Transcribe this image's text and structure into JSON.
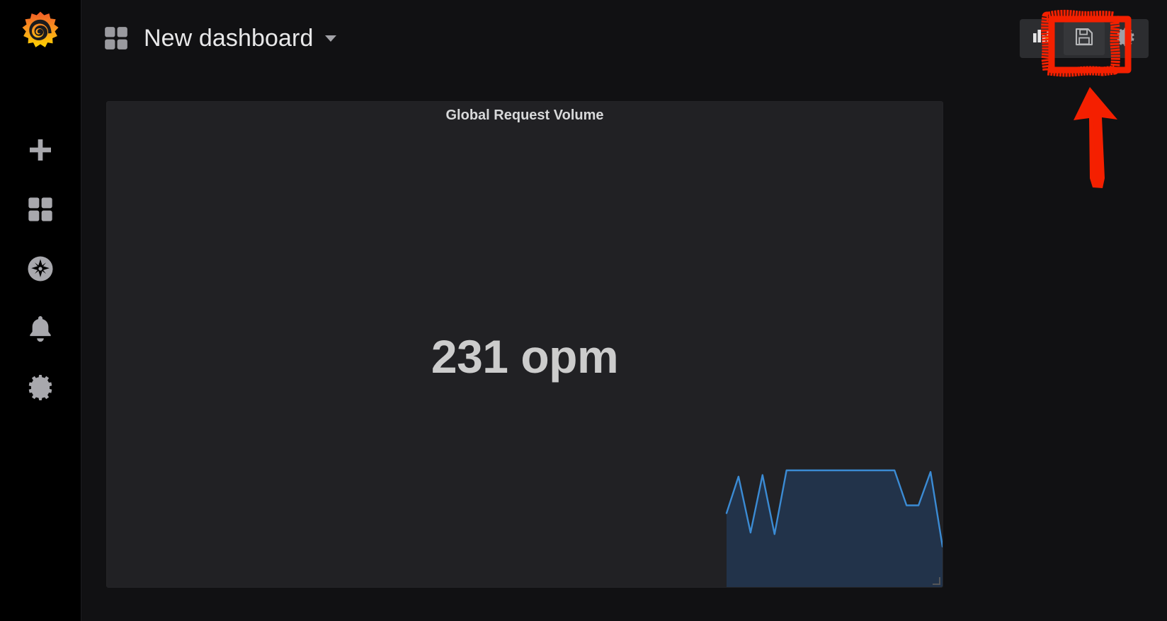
{
  "app": {
    "name": "Grafana",
    "logo_icon": "grafana-logo-icon",
    "accent_color": "#f05a28",
    "background_color": "#111113",
    "sidebar_color": "#000000",
    "panel_color": "#212124"
  },
  "sidebar": {
    "items": [
      {
        "name": "create",
        "icon": "plus-icon",
        "label": "Create"
      },
      {
        "name": "dashboards",
        "icon": "dashboards-icon",
        "label": "Dashboards"
      },
      {
        "name": "explore",
        "icon": "compass-icon",
        "label": "Explore"
      },
      {
        "name": "alerting",
        "icon": "bell-icon",
        "label": "Alerting"
      },
      {
        "name": "configuration",
        "icon": "gear-icon",
        "label": "Configuration"
      }
    ]
  },
  "header": {
    "dashboard_icon": "dashboards-icon",
    "title": "New dashboard",
    "caret_icon": "chevron-down-icon",
    "toolbar": {
      "buttons": [
        {
          "name": "add-panel",
          "icon": "add-panel-icon",
          "label": "Add panel",
          "active": false
        },
        {
          "name": "save-dashboard",
          "icon": "save-floppy-icon",
          "label": "Save dashboard",
          "active": true
        },
        {
          "name": "dashboard-settings",
          "icon": "gear-icon",
          "label": "Dashboard settings",
          "active": false
        }
      ]
    }
  },
  "panel": {
    "title": "Global Request Volume",
    "stat_value": "231 opm",
    "resize_handle_icon": "resize-corner-icon"
  },
  "annotation": {
    "color": "#f42000",
    "highlight_target": "save-dashboard",
    "shapes": [
      "rough-rectangle-around-save-button",
      "up-arrow-pointing-to-save-button"
    ]
  },
  "chart_data": {
    "type": "area",
    "title": "Global Request Volume",
    "xlabel": "",
    "ylabel": "",
    "series": [
      {
        "name": "opm",
        "line_color": "#3b8bd4",
        "fill_color": "#22334a",
        "values": [
          45,
          92,
          20,
          94,
          18,
          100,
          100,
          100,
          100,
          100,
          100,
          100,
          100,
          100,
          100,
          55,
          55,
          98,
          2
        ]
      }
    ],
    "ylim": [
      0,
      100
    ],
    "grid": false,
    "legend": "none"
  }
}
